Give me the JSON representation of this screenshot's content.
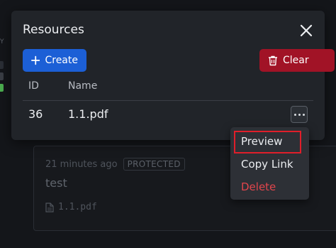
{
  "background": {
    "side_letter": "Y",
    "indicator_colors": [
      "#2b2f36",
      "#3a3e45",
      "#4caf50"
    ],
    "card": {
      "time_ago": "21 minutes ago",
      "badge": "PROTECTED",
      "title": "test",
      "file_name": "1.1.pdf"
    }
  },
  "dialog": {
    "title": "Resources",
    "create_label": "Create",
    "clear_label": "Clear",
    "columns": [
      "ID",
      "Name"
    ],
    "rows": [
      {
        "id": "36",
        "name": "1.1.pdf"
      }
    ]
  },
  "menu": {
    "items": [
      "Preview",
      "Copy Link",
      "Delete"
    ],
    "highlighted": "Preview"
  },
  "colors": {
    "primary": "#1c5fd6",
    "danger": "#a11326",
    "highlight": "#e01e2a",
    "delete_text": "#e2454c"
  }
}
